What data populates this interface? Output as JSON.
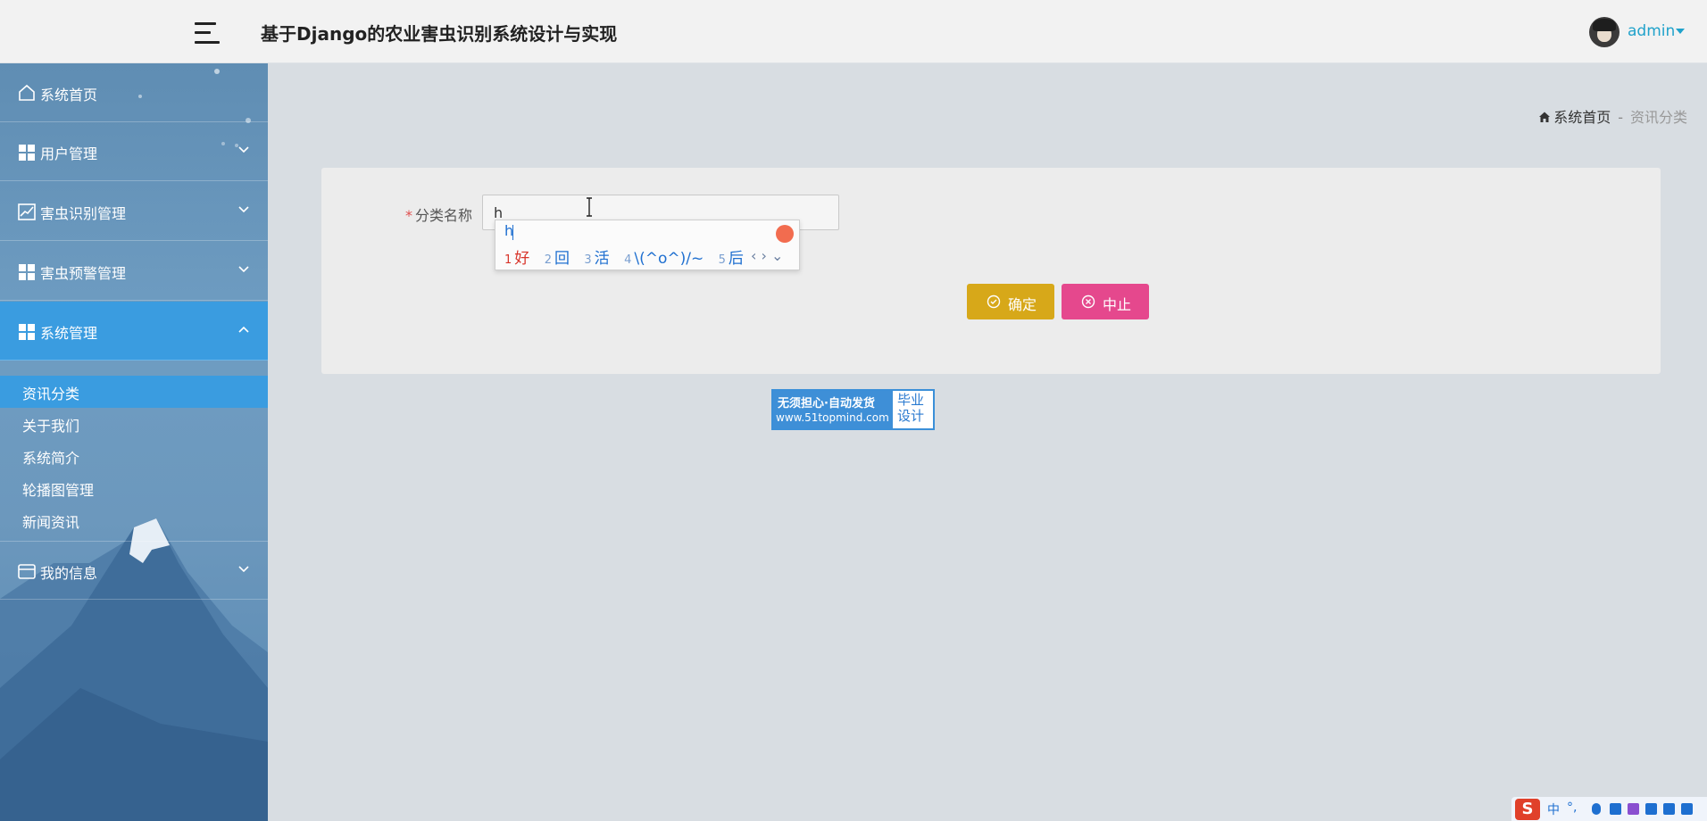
{
  "header": {
    "title": "基于Django的农业害虫识别系统设计与实现",
    "user": "admin"
  },
  "sidebar": {
    "items": [
      {
        "label": "系统首页",
        "icon": "home-icon"
      },
      {
        "label": "用户管理",
        "icon": "grid-icon",
        "expanded": false
      },
      {
        "label": "害虫识别管理",
        "icon": "chart-icon",
        "expanded": false
      },
      {
        "label": "害虫预警管理",
        "icon": "grid-icon",
        "expanded": false
      },
      {
        "label": "系统管理",
        "icon": "grid-icon",
        "expanded": true
      },
      {
        "label": "我的信息",
        "icon": "wallet-icon",
        "expanded": false
      }
    ],
    "subitems": [
      {
        "label": "资讯分类",
        "active": true
      },
      {
        "label": "关于我们"
      },
      {
        "label": "系统简介"
      },
      {
        "label": "轮播图管理"
      },
      {
        "label": "新闻资讯"
      }
    ]
  },
  "breadcrumb": {
    "home": "系统首页",
    "separator": "-",
    "current": "资讯分类"
  },
  "form": {
    "required_mark": "*",
    "label": "分类名称",
    "value": "h"
  },
  "ime": {
    "composition": "h",
    "candidates": [
      {
        "num": "1",
        "text": "好"
      },
      {
        "num": "2",
        "text": "回"
      },
      {
        "num": "3",
        "text": "活"
      },
      {
        "num": "4",
        "text": "\\(^o^)/~"
      },
      {
        "num": "5",
        "text": "后"
      }
    ],
    "arrows": "‹ › ⌄",
    "status_lang": "中",
    "status_punct": "°,"
  },
  "buttons": {
    "ok": "确定",
    "cancel": "中止"
  },
  "promo": {
    "line1": "无须担心·自动发货",
    "line2": "www.51topmind.com",
    "right1": "毕业",
    "right2": "设计"
  },
  "colors": {
    "accent": "#3a9ce0",
    "ok": "#d7a819",
    "cancel": "#e5488d",
    "user": "#20a2cb"
  }
}
